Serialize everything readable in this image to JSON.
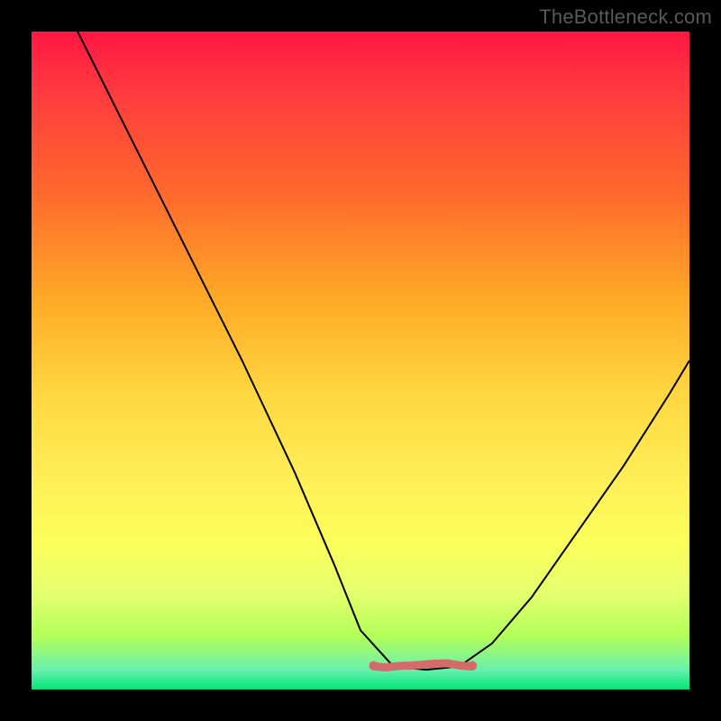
{
  "watermark": "TheBottleneck.com",
  "chart_data": {
    "type": "line",
    "title": "",
    "xlabel": "",
    "ylabel": "",
    "xlim": [
      0,
      1
    ],
    "ylim": [
      0,
      1
    ],
    "floor_region": {
      "x_start": 0.52,
      "x_end": 0.67,
      "y": 0.035
    },
    "series": [
      {
        "name": "curve",
        "points": [
          {
            "x": 0.07,
            "y": 1.0
          },
          {
            "x": 0.12,
            "y": 0.9
          },
          {
            "x": 0.18,
            "y": 0.78
          },
          {
            "x": 0.25,
            "y": 0.64
          },
          {
            "x": 0.32,
            "y": 0.5
          },
          {
            "x": 0.4,
            "y": 0.33
          },
          {
            "x": 0.46,
            "y": 0.19
          },
          {
            "x": 0.5,
            "y": 0.09
          },
          {
            "x": 0.55,
            "y": 0.035
          },
          {
            "x": 0.6,
            "y": 0.03
          },
          {
            "x": 0.65,
            "y": 0.035
          },
          {
            "x": 0.7,
            "y": 0.07
          },
          {
            "x": 0.76,
            "y": 0.14
          },
          {
            "x": 0.83,
            "y": 0.24
          },
          {
            "x": 0.9,
            "y": 0.34
          },
          {
            "x": 0.97,
            "y": 0.45
          },
          {
            "x": 1.0,
            "y": 0.5
          }
        ]
      }
    ]
  }
}
